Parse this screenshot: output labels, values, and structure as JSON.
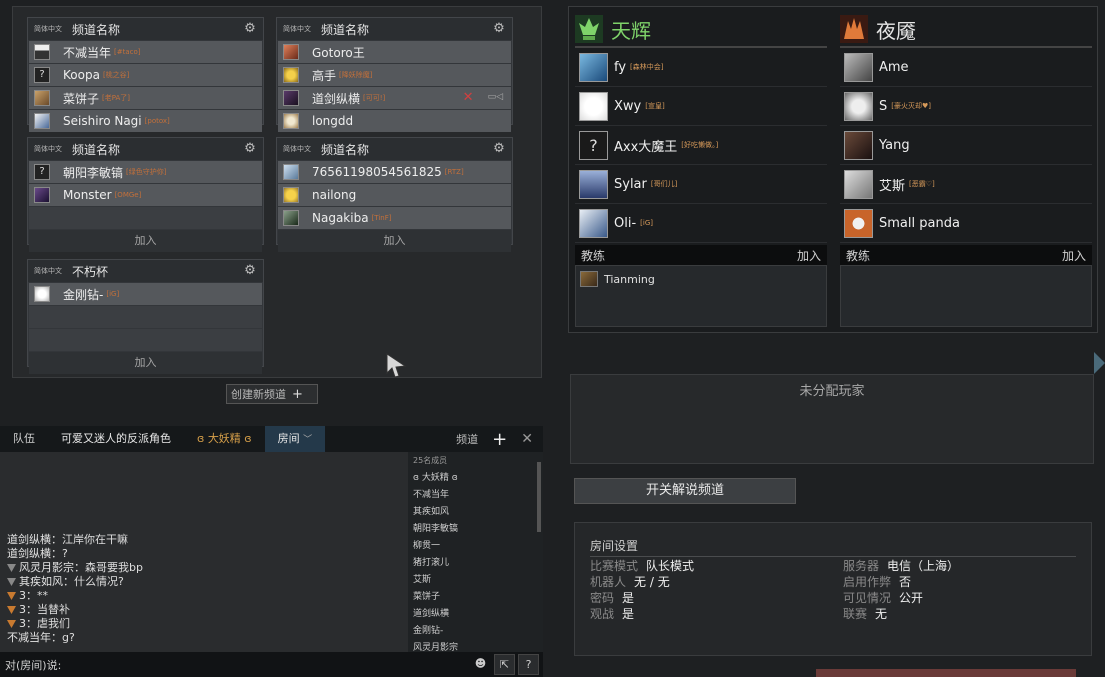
{
  "channels": [
    {
      "lang": "简体中文",
      "name": "频道名称",
      "players": [
        {
          "name": "不减当年",
          "tag": "[#taco]"
        },
        {
          "name": "Koopa",
          "tag": "[桃之谷]"
        },
        {
          "name": "菜饼子",
          "tag": "[老PA了]"
        },
        {
          "name": "Seishiro Nagi",
          "tag": "[potox]"
        }
      ],
      "join": ""
    },
    {
      "lang": "简体中文",
      "name": "频道名称",
      "players": [
        {
          "name": "Gotoro王",
          "tag": ""
        },
        {
          "name": "高手",
          "tag": "[降妖除魔]"
        },
        {
          "name": "道剑纵横",
          "tag": "[可可!]"
        },
        {
          "name": "longdd",
          "tag": ""
        }
      ],
      "join": ""
    },
    {
      "lang": "简体中文",
      "name": "频道名称",
      "players": [
        {
          "name": "朝阳李敏镐",
          "tag": "[绿色守护你]"
        },
        {
          "name": "Monster",
          "tag": "[OMGe]"
        }
      ],
      "join": "加入"
    },
    {
      "lang": "简体中文",
      "name": "频道名称",
      "players": [
        {
          "name": "76561198054561825",
          "tag": "[RTZ]"
        },
        {
          "name": "nailong",
          "tag": ""
        },
        {
          "name": "Nagakiba",
          "tag": "[TinF]"
        }
      ],
      "join": "加入"
    },
    {
      "lang": "简体中文",
      "name": "不朽杯",
      "players": [
        {
          "name": "金刚钻-",
          "tag": "[iG]"
        }
      ],
      "join": "加入"
    }
  ],
  "create_channel": "创建新频道",
  "chat": {
    "tabs": [
      "队伍",
      "可爱又迷人的反派角色",
      "大妖精",
      "房间"
    ],
    "channel_label": "频道",
    "messages": [
      {
        "who": "道剑纵横",
        "text": "：江岸你在干嘛"
      },
      {
        "who": "道剑纵横",
        "text": "：?"
      },
      {
        "who": "风灵月影宗",
        "text": "：森哥要我bp"
      },
      {
        "who": "其疾如风",
        "text": "：什么情况?"
      },
      {
        "who": "3",
        "text": "：**"
      },
      {
        "who": "3",
        "text": "：当替补"
      },
      {
        "who": "3",
        "text": "：虐我们"
      },
      {
        "who": "不减当年",
        "text": "：g?"
      }
    ],
    "member_count": "25名成员",
    "members": [
      "大妖精",
      "不减当年",
      "其疾如风",
      "朝阳李敏镐",
      "柳贯一",
      "猪打滚儿",
      "艾斯",
      "菜饼子",
      "道剑纵横",
      "金刚钻-",
      "风灵月影宗"
    ],
    "input_prefix": "对(房间)说:"
  },
  "radiant": {
    "name": "天辉",
    "players": [
      {
        "name": "fy",
        "tag": "[森林中会]"
      },
      {
        "name": "Xwy",
        "tag": "[宣皇]"
      },
      {
        "name": "Axx大魔王",
        "tag": "[好吃懒做。]"
      },
      {
        "name": "Sylar",
        "tag": "[哥们儿]"
      },
      {
        "name": "Oli-",
        "tag": "[iG]"
      }
    ],
    "coach_label": "教练",
    "join_label": "加入",
    "coach": "Tianming"
  },
  "dire": {
    "name": "夜魇",
    "players": [
      {
        "name": "Ame",
        "tag": ""
      },
      {
        "name": "S",
        "tag": "[豪火灭却♥]"
      },
      {
        "name": "Yang",
        "tag": ""
      },
      {
        "name": "艾斯",
        "tag": "[恶霸♡]"
      },
      {
        "name": "Small panda",
        "tag": ""
      }
    ],
    "coach_label": "教练",
    "join_label": "加入",
    "coach": ""
  },
  "unassigned_label": "未分配玩家",
  "caster_toggle": "开关解说频道",
  "room_settings": {
    "title": "房间设置",
    "left": [
      {
        "k": "比赛模式",
        "v": "队长模式"
      },
      {
        "k": "机器人",
        "v": "无 / 无"
      },
      {
        "k": "密码",
        "v": "是"
      },
      {
        "k": "观战",
        "v": "是"
      }
    ],
    "right": [
      {
        "k": "服务器",
        "v": "电信（上海）"
      },
      {
        "k": "启用作弊",
        "v": "否"
      },
      {
        "k": "可见情况",
        "v": "公开"
      },
      {
        "k": "联赛",
        "v": "无"
      }
    ]
  },
  "colors": {
    "radiant": "#7fd36a",
    "player_tag": "#c4703a",
    "kick": "#d04040"
  }
}
